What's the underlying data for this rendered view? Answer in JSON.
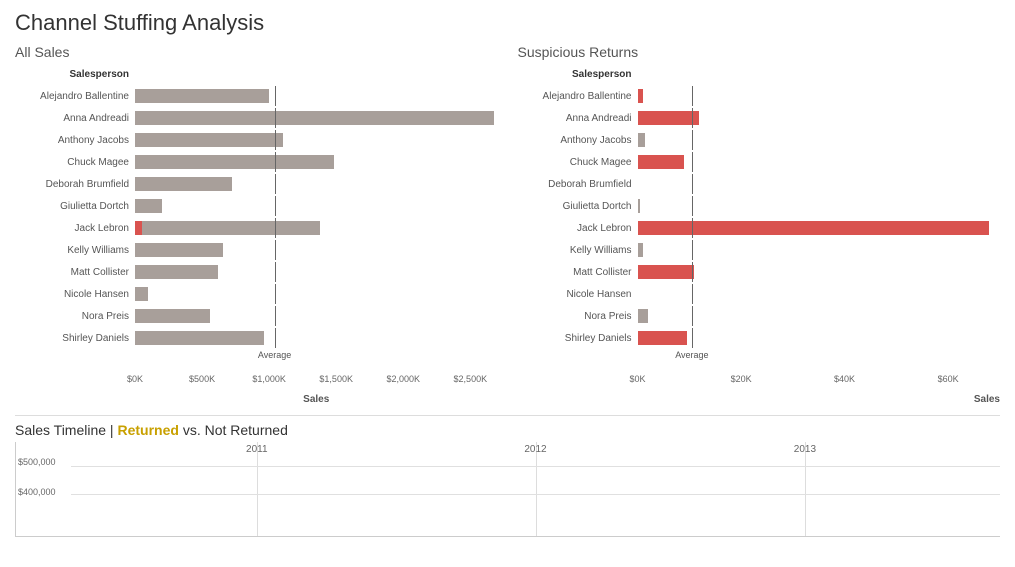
{
  "title": "Channel Stuffing Analysis",
  "allSales": {
    "sectionTitle": "All Sales",
    "columnHeader": "Salesperson",
    "xAxisTitle": "Sales",
    "maxValue": 2700000,
    "avgLinePercent": 38.5,
    "avgLabel": "Average",
    "xTicks": [
      "$0K",
      "$500K",
      "$1,000K",
      "$1,500K",
      "$2,000K",
      "$2,500K"
    ],
    "xTickPercents": [
      0,
      18.5,
      37,
      55.5,
      74,
      92.5
    ],
    "bars": [
      {
        "label": "Alejandro Ballentine",
        "value": 1000000,
        "type": "gray",
        "widthPct": 37
      },
      {
        "label": "Anna Andreadi",
        "value": 2680000,
        "type": "gray",
        "widthPct": 99
      },
      {
        "label": "Anthony Jacobs",
        "value": 1100000,
        "type": "gray",
        "widthPct": 40.7
      },
      {
        "label": "Chuck Magee",
        "value": 1480000,
        "type": "gray",
        "widthPct": 54.8
      },
      {
        "label": "Deborah Brumfield",
        "value": 720000,
        "type": "gray",
        "widthPct": 26.7
      },
      {
        "label": "Giulietta Dortch",
        "value": 200000,
        "type": "gray",
        "widthPct": 7.4
      },
      {
        "label": "Jack Lebron",
        "value": 1380000,
        "type": "mixed",
        "widthPct": 51.1,
        "redPct": 2
      },
      {
        "label": "Kelly Williams",
        "value": 660000,
        "type": "gray",
        "widthPct": 24.4
      },
      {
        "label": "Matt Collister",
        "value": 620000,
        "type": "gray",
        "widthPct": 23
      },
      {
        "label": "Nicole Hansen",
        "value": 100000,
        "type": "gray",
        "widthPct": 3.7
      },
      {
        "label": "Nora Preis",
        "value": 560000,
        "type": "gray",
        "widthPct": 20.7
      },
      {
        "label": "Shirley Daniels",
        "value": 960000,
        "type": "gray",
        "widthPct": 35.6
      }
    ]
  },
  "suspiciousReturns": {
    "sectionTitle": "Suspicious Returns",
    "columnHeader": "Salesperson",
    "xAxisTitle": "Sales",
    "maxValue": 70000,
    "avgLinePercent": 15,
    "avgLabel": "Average",
    "xTicks": [
      "$0K",
      "$20K",
      "$40K",
      "$60K"
    ],
    "xTickPercents": [
      0,
      28.6,
      57.1,
      85.7
    ],
    "bars": [
      {
        "label": "Alejandro Ballentine",
        "value": 1000,
        "type": "red",
        "widthPct": 1.4
      },
      {
        "label": "Anna Andreadi",
        "value": 12000,
        "type": "red",
        "widthPct": 17.1
      },
      {
        "label": "Anthony Jacobs",
        "value": 1500,
        "type": "gray",
        "widthPct": 2.1
      },
      {
        "label": "Chuck Magee",
        "value": 9000,
        "type": "red",
        "widthPct": 12.9
      },
      {
        "label": "Giulietta Dortch",
        "value": 500,
        "type": "gray",
        "widthPct": 0.7
      },
      {
        "label": "Jack Lebron",
        "value": 68000,
        "type": "red",
        "widthPct": 97.1
      },
      {
        "label": "Kelly Williams",
        "value": 1000,
        "type": "gray",
        "widthPct": 1.4
      },
      {
        "label": "Matt Collister",
        "value": 11000,
        "type": "red",
        "widthPct": 15.7
      },
      {
        "label": "Nora Preis",
        "value": 2000,
        "type": "gray",
        "widthPct": 2.9
      },
      {
        "label": "Shirley Daniels",
        "value": 9500,
        "type": "red",
        "widthPct": 13.6
      }
    ]
  },
  "timeline": {
    "sectionTitle": "Sales Timeline",
    "returnedLabel": "Returned",
    "vsLabel": "vs. Not Returned",
    "years": [
      "2011",
      "2012",
      "2013"
    ],
    "yearPositions": [
      20,
      50,
      79
    ],
    "yLabels": [
      "$500,000",
      "$400,000"
    ],
    "yPositions": [
      25,
      55
    ]
  }
}
